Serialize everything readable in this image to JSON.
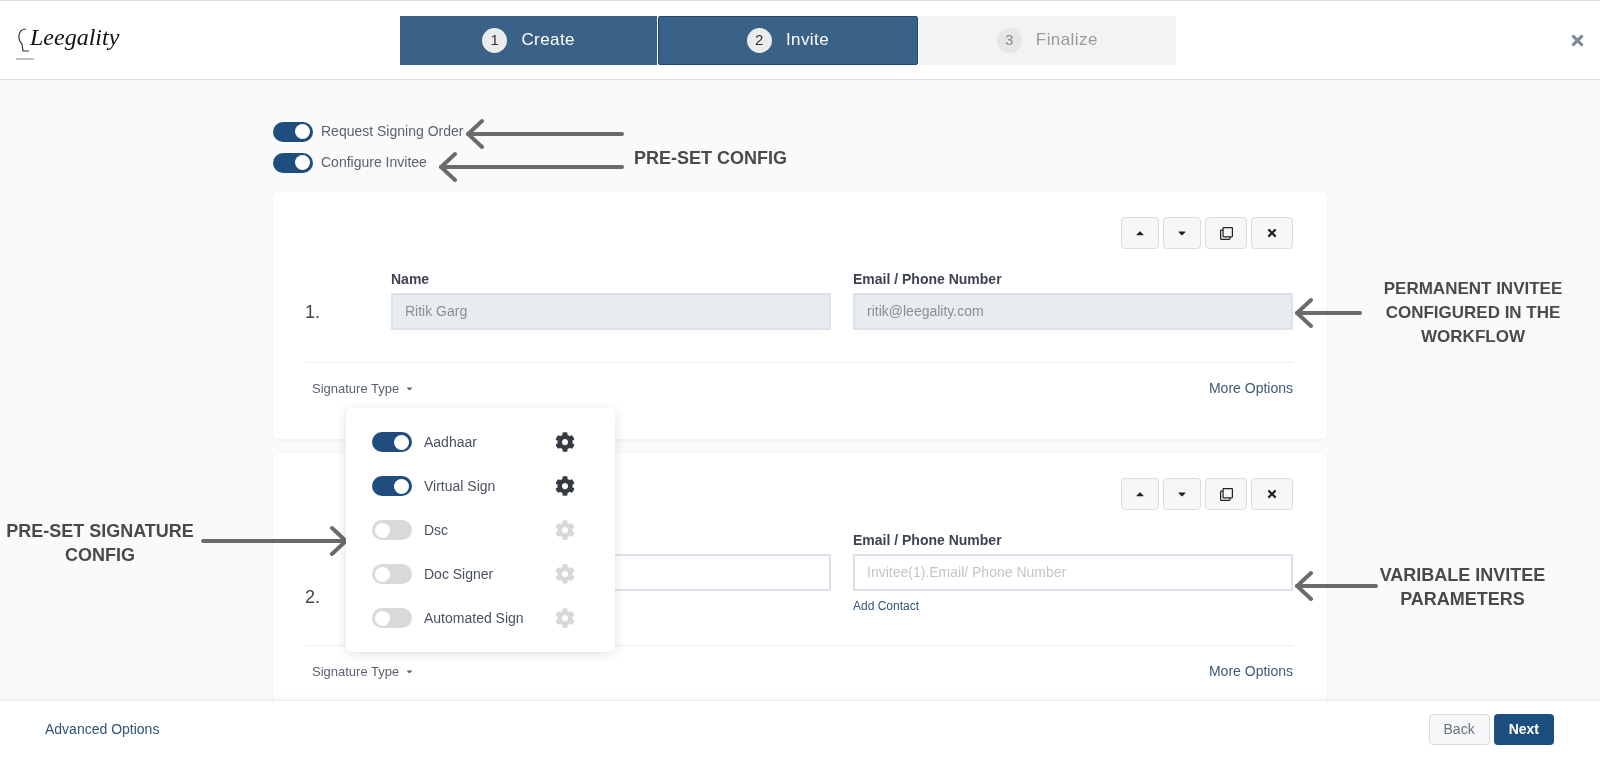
{
  "logo": {
    "text": "Leegality"
  },
  "steps": [
    {
      "number": "1",
      "label": "Create",
      "selected": false,
      "disabled": false
    },
    {
      "number": "2",
      "label": "Invite",
      "selected": true,
      "disabled": false
    },
    {
      "number": "3",
      "label": "Finalize",
      "selected": false,
      "disabled": true
    }
  ],
  "options": [
    {
      "label": "Request Signing Order",
      "on": true
    },
    {
      "label": "Configure Invitee",
      "on": true
    }
  ],
  "invitees": [
    {
      "number": "1.",
      "name_label": "Name",
      "name_value": "Ritik Garg",
      "email_label": "Email / Phone Number",
      "email_value": "ritik@leegality.com",
      "locked": true,
      "signature_type": "Signature Type",
      "more_options": "More Options"
    },
    {
      "number": "2.",
      "email_label": "Email / Phone Number",
      "email_placeholder": "Invitee(1).Email/ Phone Number",
      "add_contact": "Add Contact",
      "locked": false,
      "signature_type": "Signature Type",
      "more_options": "More Options"
    }
  ],
  "signature_menu": {
    "items": [
      {
        "label": "Aadhaar",
        "on": true
      },
      {
        "label": "Virtual Sign",
        "on": true
      },
      {
        "label": "Dsc",
        "on": false
      },
      {
        "label": "Doc Signer",
        "on": false
      },
      {
        "label": "Automated Sign",
        "on": false
      }
    ]
  },
  "annotations": {
    "preset_config": "PRE-SET CONFIG",
    "permanent_invitee": "PERMANENT INVITEE CONFIGURED IN THE WORKFLOW",
    "preset_signature": "PRE-SET SIGNATURE CONFIG",
    "variable_invitee": "VARIBALE INVITEE PARAMETERS"
  },
  "footer": {
    "advanced": "Advanced Options",
    "back": "Back",
    "next": "Next"
  }
}
